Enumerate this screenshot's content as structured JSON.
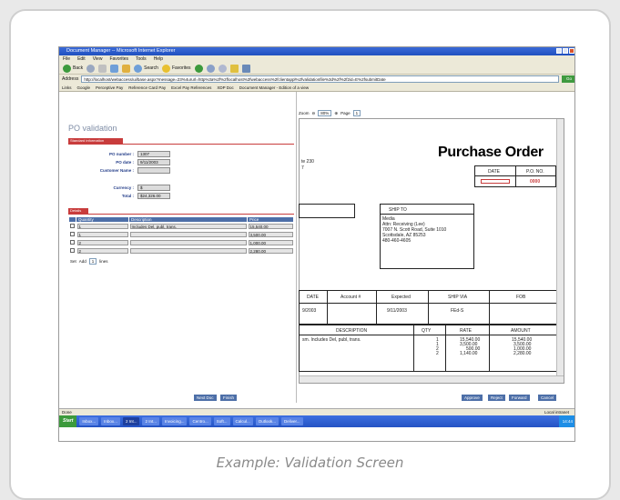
{
  "caption": "Example: Validation Screen",
  "browser": {
    "title": "Document Manager -- Microsoft Internet Explorer",
    "menu": [
      "File",
      "Edit",
      "View",
      "Favorites",
      "Tools",
      "Help"
    ],
    "toolbar": {
      "back": "Back",
      "search": "Search",
      "favorites": "Favorites"
    },
    "address_label": "Address",
    "address": "http://localhost/webaccess/ui/base.aspx?message=23%4ururl=http%3a%2f%2flocalhost%2fwebaccess%2fclientappl%2fvalidationfile%3d%2f%2f2id=E%2fsubmitDate",
    "go": "Go",
    "links_label": "Links",
    "links": [
      "Google",
      "Perceptive Pay",
      "Reference Card Pay",
      "Excel Pay References",
      "XDP Doc",
      "Document Manager - Edition of a view"
    ],
    "status": "Done",
    "status_zone": "Local intranet"
  },
  "left": {
    "title": "PO validation",
    "section_bar": "Standard information",
    "fields": [
      {
        "label": "PO number :",
        "value": "1307"
      },
      {
        "label": "PO date :",
        "value": "9/11/2003"
      },
      {
        "label": "Customer Name :",
        "value": ""
      },
      {
        "label": "Currency :",
        "value": "$"
      },
      {
        "label": "Total :",
        "value": "$24,326.00"
      }
    ],
    "details_bar": "Details",
    "table": {
      "headers": [
        "Quantity",
        "Description",
        "Price"
      ],
      "rows": [
        {
          "qty": "1",
          "desc": "Includes Del, publ, trans.",
          "price": "15,540.00"
        },
        {
          "qty": "1",
          "desc": "",
          "price": "3,500.00"
        },
        {
          "qty": "2",
          "desc": "",
          "price": "1,000.00"
        },
        {
          "qty": "2",
          "desc": "",
          "price": "2,280.00"
        }
      ]
    },
    "add_row": {
      "prefix": "Set",
      "verb": "Add",
      "count": "1",
      "suffix": "lines"
    },
    "buttons": [
      "Next Doc",
      "Finish"
    ]
  },
  "right": {
    "zoom_label": "Zoom",
    "zoom_value": "80%",
    "page_label": "Page",
    "page_value": "1",
    "doc": {
      "title": "Purchase Order",
      "date_hdr": "DATE",
      "po_hdr": "P.O. NO.",
      "po_no": "0000",
      "addr_frag": [
        "te 230",
        "7"
      ],
      "shipto_hdr": "SHIP TO",
      "shipto": [
        "Media",
        "Attn: Receiving (Lee)",
        "7007 N. Scott Road, Suite 1010",
        "Scottsdale, AZ 85253",
        "480-460-4605"
      ],
      "cols1": [
        "DATE",
        "Account #",
        "Expected",
        "SHIP VIA",
        "FOB"
      ],
      "vals1": [
        "9/2003",
        "",
        "9/11/2003",
        "FEd-S",
        ""
      ],
      "cols2": [
        "DESCRIPTION",
        "QTY",
        "RATE",
        "AMOUNT"
      ],
      "desc": "sm. Includes Del, publ, trans.",
      "qty": [
        "1",
        "1",
        "2",
        "2"
      ],
      "rate": [
        "15,540.00",
        "3,500.00",
        "500.00",
        "1,140.00"
      ],
      "amount": [
        "15,540.00",
        "3,500.00",
        "1,000.00",
        "2,280.00"
      ]
    },
    "buttons": [
      "Approve",
      "Reject",
      "Forward",
      "Cancel"
    ]
  },
  "taskbar": {
    "start": "Start",
    "tasks": [
      "Inbox...",
      "Inbox...",
      "2 Int...",
      "2 Int...",
      "Invoicing...",
      "Centro...",
      "Soft...",
      "Calcul...",
      "Outlook...",
      "Deliver..."
    ],
    "clock": "14:44"
  }
}
